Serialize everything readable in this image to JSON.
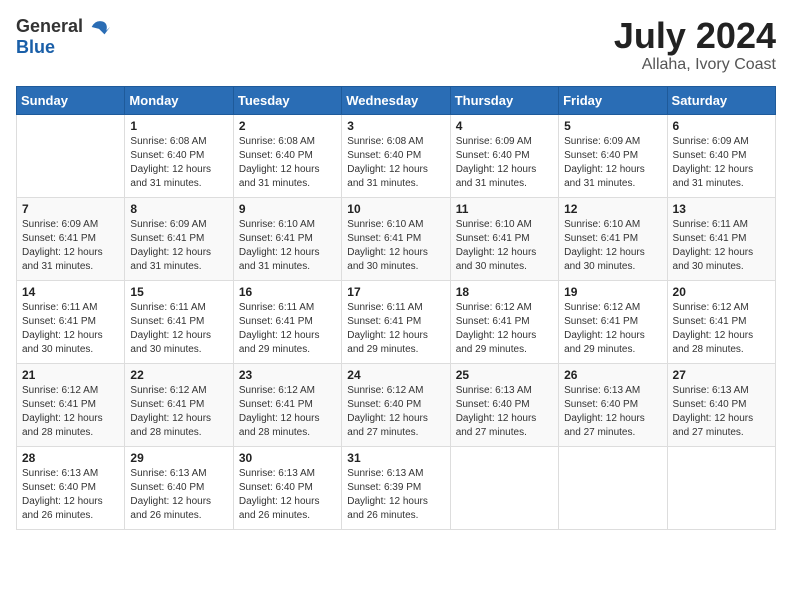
{
  "logo": {
    "general": "General",
    "blue": "Blue"
  },
  "header": {
    "month": "July 2024",
    "location": "Allaha, Ivory Coast"
  },
  "weekdays": [
    "Sunday",
    "Monday",
    "Tuesday",
    "Wednesday",
    "Thursday",
    "Friday",
    "Saturday"
  ],
  "weeks": [
    [
      {
        "day": null
      },
      {
        "day": 1,
        "sunrise": "6:08 AM",
        "sunset": "6:40 PM",
        "daylight": "12 hours and 31 minutes."
      },
      {
        "day": 2,
        "sunrise": "6:08 AM",
        "sunset": "6:40 PM",
        "daylight": "12 hours and 31 minutes."
      },
      {
        "day": 3,
        "sunrise": "6:08 AM",
        "sunset": "6:40 PM",
        "daylight": "12 hours and 31 minutes."
      },
      {
        "day": 4,
        "sunrise": "6:09 AM",
        "sunset": "6:40 PM",
        "daylight": "12 hours and 31 minutes."
      },
      {
        "day": 5,
        "sunrise": "6:09 AM",
        "sunset": "6:40 PM",
        "daylight": "12 hours and 31 minutes."
      },
      {
        "day": 6,
        "sunrise": "6:09 AM",
        "sunset": "6:40 PM",
        "daylight": "12 hours and 31 minutes."
      }
    ],
    [
      {
        "day": 7,
        "sunrise": "6:09 AM",
        "sunset": "6:41 PM",
        "daylight": "12 hours and 31 minutes."
      },
      {
        "day": 8,
        "sunrise": "6:09 AM",
        "sunset": "6:41 PM",
        "daylight": "12 hours and 31 minutes."
      },
      {
        "day": 9,
        "sunrise": "6:10 AM",
        "sunset": "6:41 PM",
        "daylight": "12 hours and 31 minutes."
      },
      {
        "day": 10,
        "sunrise": "6:10 AM",
        "sunset": "6:41 PM",
        "daylight": "12 hours and 30 minutes."
      },
      {
        "day": 11,
        "sunrise": "6:10 AM",
        "sunset": "6:41 PM",
        "daylight": "12 hours and 30 minutes."
      },
      {
        "day": 12,
        "sunrise": "6:10 AM",
        "sunset": "6:41 PM",
        "daylight": "12 hours and 30 minutes."
      },
      {
        "day": 13,
        "sunrise": "6:11 AM",
        "sunset": "6:41 PM",
        "daylight": "12 hours and 30 minutes."
      }
    ],
    [
      {
        "day": 14,
        "sunrise": "6:11 AM",
        "sunset": "6:41 PM",
        "daylight": "12 hours and 30 minutes."
      },
      {
        "day": 15,
        "sunrise": "6:11 AM",
        "sunset": "6:41 PM",
        "daylight": "12 hours and 30 minutes."
      },
      {
        "day": 16,
        "sunrise": "6:11 AM",
        "sunset": "6:41 PM",
        "daylight": "12 hours and 29 minutes."
      },
      {
        "day": 17,
        "sunrise": "6:11 AM",
        "sunset": "6:41 PM",
        "daylight": "12 hours and 29 minutes."
      },
      {
        "day": 18,
        "sunrise": "6:12 AM",
        "sunset": "6:41 PM",
        "daylight": "12 hours and 29 minutes."
      },
      {
        "day": 19,
        "sunrise": "6:12 AM",
        "sunset": "6:41 PM",
        "daylight": "12 hours and 29 minutes."
      },
      {
        "day": 20,
        "sunrise": "6:12 AM",
        "sunset": "6:41 PM",
        "daylight": "12 hours and 28 minutes."
      }
    ],
    [
      {
        "day": 21,
        "sunrise": "6:12 AM",
        "sunset": "6:41 PM",
        "daylight": "12 hours and 28 minutes."
      },
      {
        "day": 22,
        "sunrise": "6:12 AM",
        "sunset": "6:41 PM",
        "daylight": "12 hours and 28 minutes."
      },
      {
        "day": 23,
        "sunrise": "6:12 AM",
        "sunset": "6:41 PM",
        "daylight": "12 hours and 28 minutes."
      },
      {
        "day": 24,
        "sunrise": "6:12 AM",
        "sunset": "6:40 PM",
        "daylight": "12 hours and 27 minutes."
      },
      {
        "day": 25,
        "sunrise": "6:13 AM",
        "sunset": "6:40 PM",
        "daylight": "12 hours and 27 minutes."
      },
      {
        "day": 26,
        "sunrise": "6:13 AM",
        "sunset": "6:40 PM",
        "daylight": "12 hours and 27 minutes."
      },
      {
        "day": 27,
        "sunrise": "6:13 AM",
        "sunset": "6:40 PM",
        "daylight": "12 hours and 27 minutes."
      }
    ],
    [
      {
        "day": 28,
        "sunrise": "6:13 AM",
        "sunset": "6:40 PM",
        "daylight": "12 hours and 26 minutes."
      },
      {
        "day": 29,
        "sunrise": "6:13 AM",
        "sunset": "6:40 PM",
        "daylight": "12 hours and 26 minutes."
      },
      {
        "day": 30,
        "sunrise": "6:13 AM",
        "sunset": "6:40 PM",
        "daylight": "12 hours and 26 minutes."
      },
      {
        "day": 31,
        "sunrise": "6:13 AM",
        "sunset": "6:39 PM",
        "daylight": "12 hours and 26 minutes."
      },
      {
        "day": null
      },
      {
        "day": null
      },
      {
        "day": null
      }
    ]
  ]
}
